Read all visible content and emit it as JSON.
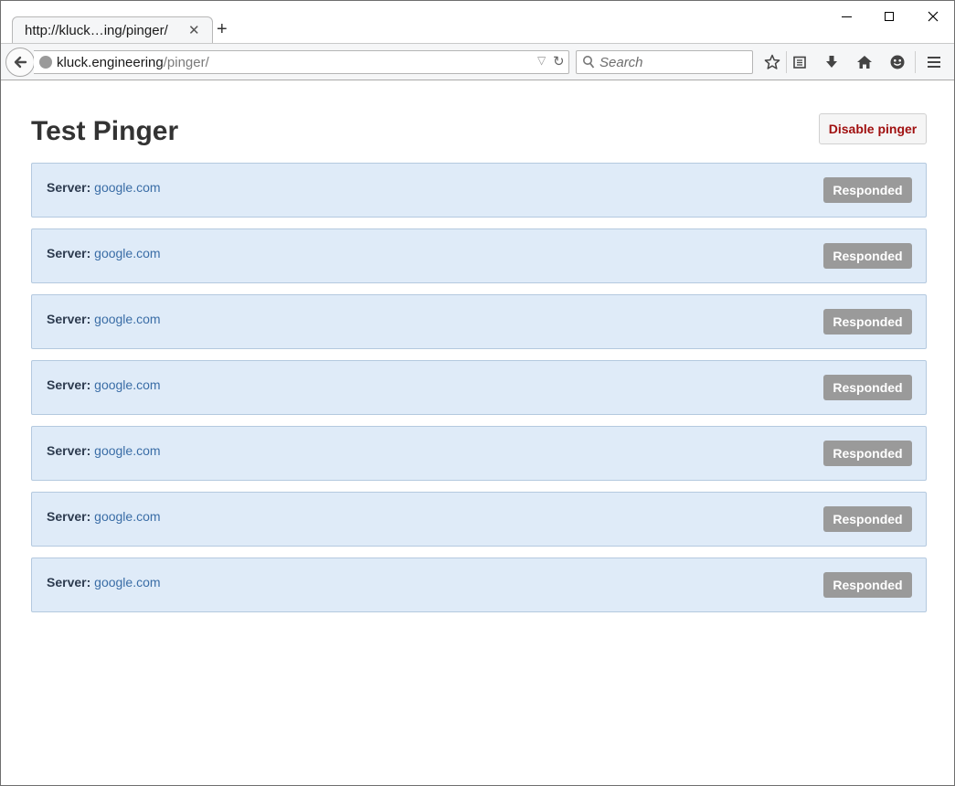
{
  "browser": {
    "tab": {
      "title": "http://kluck…ing/pinger/"
    },
    "url": {
      "host": "kluck.engineering",
      "path": "/pinger/"
    },
    "search": {
      "placeholder": "Search"
    }
  },
  "page": {
    "title": "Test Pinger",
    "disable_button": "Disable pinger",
    "server_label": "Server:",
    "servers": [
      {
        "host": "google.com",
        "status": "Responded"
      },
      {
        "host": "google.com",
        "status": "Responded"
      },
      {
        "host": "google.com",
        "status": "Responded"
      },
      {
        "host": "google.com",
        "status": "Responded"
      },
      {
        "host": "google.com",
        "status": "Responded"
      },
      {
        "host": "google.com",
        "status": "Responded"
      },
      {
        "host": "google.com",
        "status": "Responded"
      }
    ]
  },
  "colors": {
    "row_background": "#dfebf8",
    "badge_background": "#9a9a9a",
    "disable_text": "#a01010",
    "link": "#3a6da6"
  }
}
